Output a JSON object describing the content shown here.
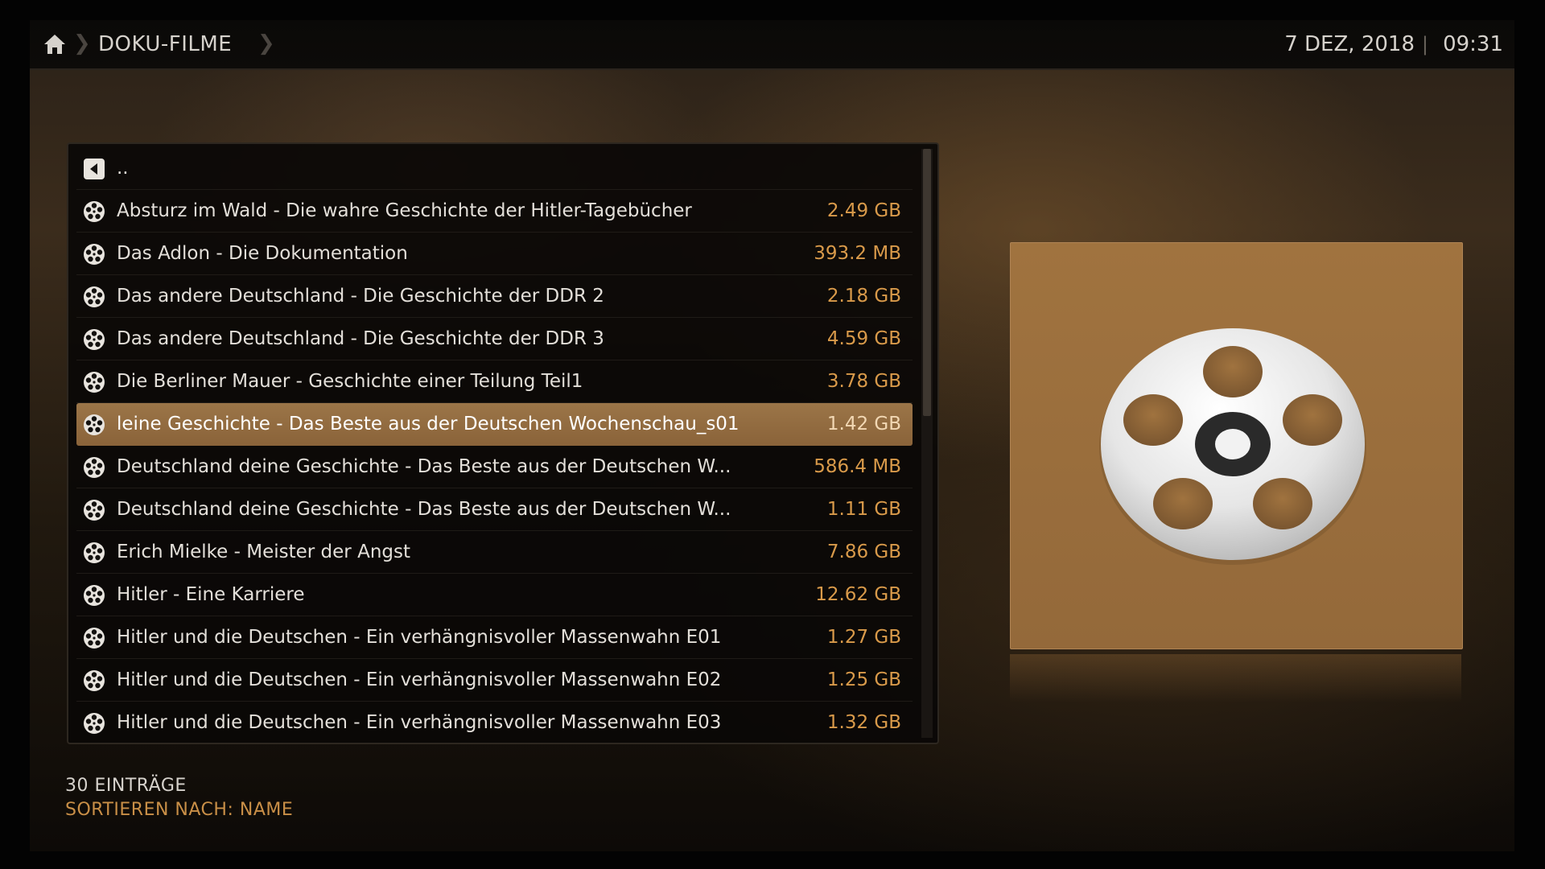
{
  "header": {
    "breadcrumb_title": "DOKU-FILME",
    "date": "7 DEZ, 2018",
    "time": "09:31"
  },
  "list": {
    "parent_label": "..",
    "items": [
      {
        "title": "Absturz im Wald - Die wahre Geschichte der Hitler-Tagebücher",
        "size": "2.49 GB"
      },
      {
        "title": "Das Adlon - Die Dokumentation",
        "size": "393.2 MB"
      },
      {
        "title": "Das andere Deutschland - Die Geschichte der DDR 2",
        "size": "2.18 GB"
      },
      {
        "title": "Das andere Deutschland - Die Geschichte der DDR 3",
        "size": "4.59 GB"
      },
      {
        "title": "Die Berliner Mauer - Geschichte einer Teilung Teil1",
        "size": "3.78 GB"
      },
      {
        "title": "leine Geschichte - Das Beste aus der Deutschen Wochenschau_s01",
        "size": "1.42 GB",
        "selected": true
      },
      {
        "title": "Deutschland deine Geschichte - Das Beste aus der Deutschen W...",
        "size": "586.4 MB"
      },
      {
        "title": "Deutschland deine Geschichte - Das Beste aus der Deutschen W...",
        "size": "1.11 GB"
      },
      {
        "title": "Erich Mielke - Meister der Angst",
        "size": "7.86 GB"
      },
      {
        "title": "Hitler - Eine Karriere",
        "size": "12.62 GB"
      },
      {
        "title": "Hitler und die Deutschen - Ein verhängnisvoller Massenwahn E01",
        "size": "1.27 GB"
      },
      {
        "title": "Hitler und die Deutschen - Ein verhängnisvoller Massenwahn E02",
        "size": "1.25 GB"
      },
      {
        "title": "Hitler und die Deutschen - Ein verhängnisvoller Massenwahn E03",
        "size": "1.32 GB"
      }
    ]
  },
  "footer": {
    "count": "30 EINTRÄGE",
    "sort": "SORTIEREN NACH: NAME"
  },
  "icons": {
    "home": "home-icon",
    "back": "back-arrow-icon",
    "item": "film-reel-icon",
    "thumbnail": "film-reel-icon"
  },
  "colors": {
    "accent": "#d99a4a",
    "selection": "#9b7548",
    "thumbnail_bg": "#a0733f"
  }
}
